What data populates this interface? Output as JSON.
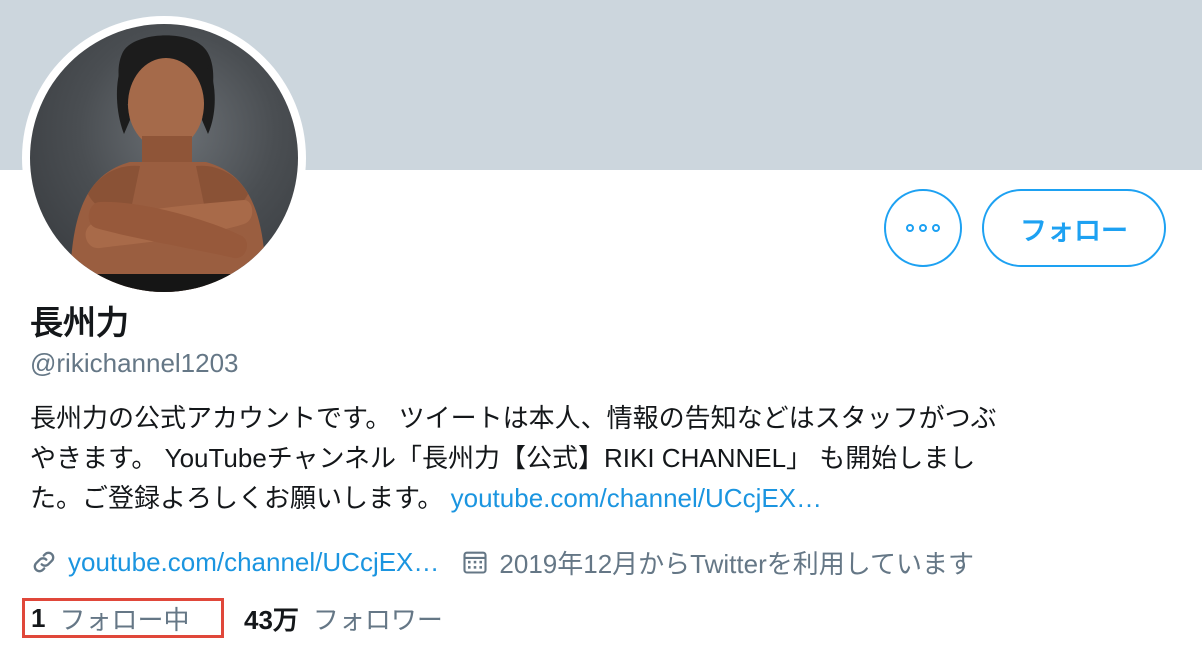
{
  "profile": {
    "display_name": "長州力",
    "handle": "@rikichannel1203",
    "bio_line1": "長州力の公式アカウントです。 ツイートは本人、情報の告知などはスタッフがつぶ",
    "bio_line2": "やきます。 YouTubeチャンネル「長州力【公式】RIKI CHANNEL」 も開始しまし",
    "bio_line3_text": "た。ご登録よろしくお願いします。 ",
    "bio_link": "youtube.com/channel/UCcjEX…"
  },
  "actions": {
    "more_icon": "more-horizontal-icon",
    "follow_label": "フォロー"
  },
  "meta": {
    "link_icon": "link-icon",
    "website": "youtube.com/channel/UCcjEX…",
    "calendar_icon": "calendar-icon",
    "joined": "2019年12月からTwitterを利用しています"
  },
  "stats": {
    "following_count": "1",
    "following_label": "フォロー中",
    "followers_count": "43万",
    "followers_label": "フォロワー"
  },
  "colors": {
    "accent": "#1da1f2",
    "link": "#1b95e0",
    "banner": "#ccd6dd",
    "muted": "#657786",
    "highlight_box": "#e0473a"
  }
}
